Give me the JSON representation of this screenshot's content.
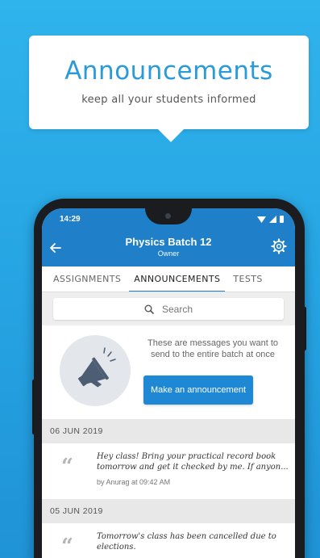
{
  "callout": {
    "title": "Announcements",
    "subtitle": "keep all your students informed"
  },
  "status_bar": {
    "time": "14:29"
  },
  "app_bar": {
    "title": "Physics Batch 12",
    "subtitle": "Owner",
    "back_icon": "arrow-left-icon",
    "settings_icon": "gear-icon"
  },
  "tabs": [
    {
      "label": "ASSIGNMENTS",
      "active": false
    },
    {
      "label": "ANNOUNCEMENTS",
      "active": true
    },
    {
      "label": "TESTS",
      "active": false
    }
  ],
  "search": {
    "placeholder": "Search"
  },
  "intro": {
    "description": "These are messages you want to send to the entire batch at once",
    "button_label": "Make an announcement"
  },
  "groups": [
    {
      "date": "06 JUN 2019",
      "messages": [
        {
          "text_line1": "Hey class! Bring your practical record book",
          "text_line2": "tomorrow and get it checked by me. If anyon...",
          "meta": "by Anurag at 09:42 AM"
        }
      ]
    },
    {
      "date": "05 JUN 2019",
      "messages": [
        {
          "text_line1": "Tomorrow's class has been cancelled due to",
          "text_line2": "elections.",
          "meta": ""
        }
      ]
    }
  ],
  "colors": {
    "background": "#29a9e6",
    "primary": "#1f7fc9",
    "button": "#1f88d4"
  }
}
